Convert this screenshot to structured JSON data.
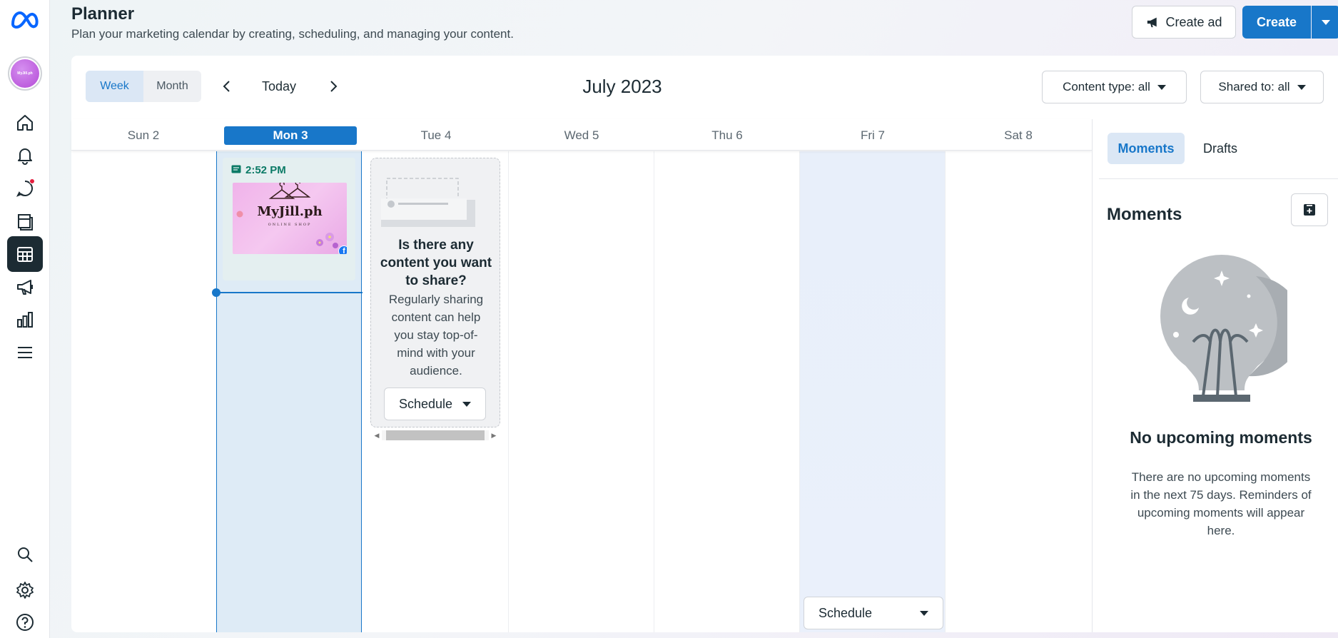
{
  "header": {
    "title": "Planner",
    "subtitle": "Plan your marketing calendar by creating, scheduling, and managing your content.",
    "create_ad_label": "Create ad",
    "create_label": "Create"
  },
  "sidebar": {
    "avatar_label": "MyJill.ph",
    "items": [
      {
        "name": "home",
        "icon": "home-icon"
      },
      {
        "name": "notifications",
        "icon": "bell-icon"
      },
      {
        "name": "inbox",
        "icon": "chat-icon"
      },
      {
        "name": "content",
        "icon": "content-icon"
      },
      {
        "name": "planner",
        "icon": "calendar-icon",
        "active": true
      },
      {
        "name": "ads",
        "icon": "megaphone-icon"
      },
      {
        "name": "insights",
        "icon": "bar-chart-icon"
      },
      {
        "name": "all-tools",
        "icon": "menu-icon"
      }
    ],
    "bottom_items": [
      {
        "name": "search",
        "icon": "search-icon"
      },
      {
        "name": "settings",
        "icon": "gear-icon"
      },
      {
        "name": "help",
        "icon": "help-icon"
      }
    ]
  },
  "toolbar": {
    "view_week": "Week",
    "view_month": "Month",
    "active_view": "Week",
    "today_label": "Today",
    "month_title": "July 2023",
    "content_filter": "Content type: all",
    "shared_filter": "Shared to: all"
  },
  "calendar": {
    "days": [
      "Sun 2",
      "Mon 3",
      "Tue 4",
      "Wed 5",
      "Thu 6",
      "Fri 7",
      "Sat 8"
    ],
    "today": "Mon 3",
    "post": {
      "time": "2:52 PM",
      "brand": "MyJill.ph",
      "brand_sub": "ONLINE SHOP",
      "platform": "facebook"
    },
    "suggestion": {
      "title": "Is there any content you want to share?",
      "body": "Regularly sharing content can help you stay top-of-mind with your audience.",
      "schedule_label": "Schedule"
    },
    "fri_schedule_label": "Schedule"
  },
  "side_panel": {
    "tab_moments": "Moments",
    "tab_drafts": "Drafts",
    "active_tab": "Moments",
    "section_title": "Moments",
    "empty_title": "No upcoming moments",
    "empty_body": "There are no upcoming moments in the next 75 days. Reminders of upcoming moments will appear here."
  },
  "colors": {
    "accent": "#1877c9",
    "today_column": "#deebf6",
    "post_card": "#e4eff0",
    "post_time": "#0b7a66",
    "notification_dot": "#e41e3f"
  }
}
